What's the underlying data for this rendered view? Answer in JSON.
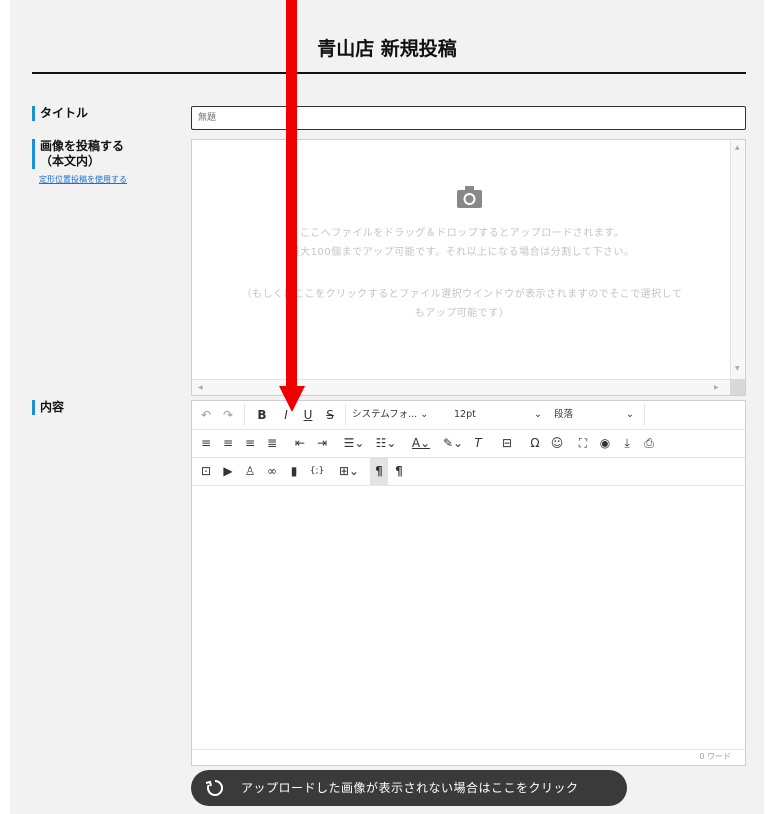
{
  "header": {
    "title": "青山店 新規投稿"
  },
  "form": {
    "title_label": "タイトル",
    "title_placeholder": "無題",
    "image_label_line1": "画像を投稿する",
    "image_label_line2": "（本文内）",
    "image_link": "定形位置投稿を使用する",
    "content_label": "内容"
  },
  "dropzone": {
    "camera_icon": "camera-icon",
    "line1": "ここへファイルをドラッグ＆ドロップするとアップロードされます。",
    "line2": "最大100個までアップ可能です。それ以上になる場合は分割して下さい。",
    "line3": "（もしくはここをクリックするとファイル選択ウインドウが表示されますのでそこで選択して",
    "line4": "もアップ可能です）"
  },
  "editor": {
    "font_family": "システムフォ...",
    "font_size": "12pt",
    "block_format": "段落",
    "word_count": "0 ワード"
  },
  "reload_button": {
    "label": "アップロードした画像が表示されない場合はここをクリック"
  },
  "colors": {
    "accent": "#1a8fd8",
    "annotation_arrow": "#ee0000",
    "button_bg": "#3a3a3a"
  }
}
